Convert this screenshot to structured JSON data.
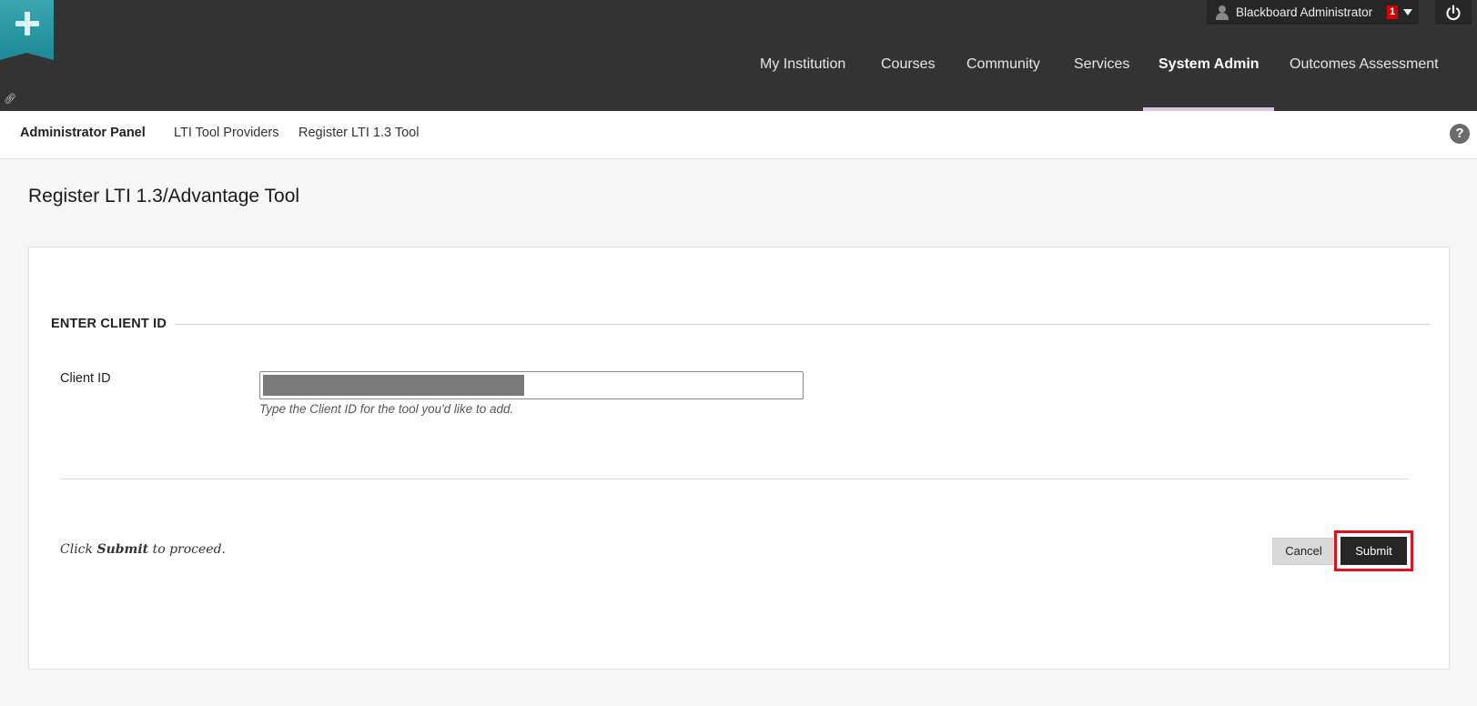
{
  "header": {
    "user_name": "Blackboard Administrator",
    "notification_count": "1",
    "nav": [
      {
        "label": "My Institution"
      },
      {
        "label": "Courses"
      },
      {
        "label": "Community"
      },
      {
        "label": "Services"
      },
      {
        "label": "System Admin",
        "active": true
      },
      {
        "label": "Outcomes Assessment"
      }
    ]
  },
  "breadcrumb": {
    "items": [
      {
        "label": "Administrator Panel"
      },
      {
        "label": "LTI Tool Providers"
      },
      {
        "label": "Register LTI 1.3 Tool"
      }
    ],
    "help_icon": "?"
  },
  "page": {
    "title": "Register LTI 1.3/Advantage Tool"
  },
  "form": {
    "section_title": "ENTER CLIENT ID",
    "client_id_label": "Client ID",
    "client_id_help": "Type the Client ID for the tool you'd like to add.",
    "proceed_prefix": "Click ",
    "proceed_bold": "Submit",
    "proceed_suffix": " to proceed.",
    "cancel_label": "Cancel",
    "submit_label": "Submit"
  },
  "colors": {
    "header_bg": "#333333",
    "accent_teal": "#2a9aa5",
    "highlight_red": "#e0121f",
    "notif_red": "#d60000"
  }
}
